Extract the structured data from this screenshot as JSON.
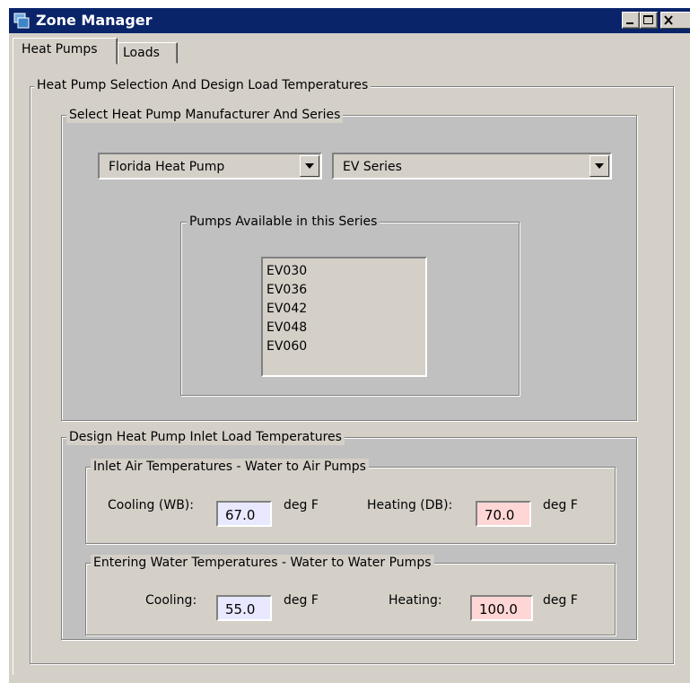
{
  "window": {
    "title": "Zone Manager",
    "controls": {
      "minimize": "minimize-icon",
      "maximize": "maximize-icon",
      "close": "close-icon"
    }
  },
  "tabs": [
    {
      "label": "Heat Pumps",
      "selected": true
    },
    {
      "label": "Loads",
      "selected": false
    }
  ],
  "main_group": {
    "legend": "Heat Pump Selection And Design Load Temperatures"
  },
  "manufacturer_group": {
    "legend": "Select Heat Pump Manufacturer And Series",
    "manufacturer": "Florida Heat Pump",
    "series": "EV Series",
    "pumps_group": {
      "legend": "Pumps Available in this Series",
      "items": [
        "EV030",
        "EV036",
        "EV042",
        "EV048",
        "EV060"
      ]
    }
  },
  "design_group": {
    "legend": "Design Heat Pump Inlet Load Temperatures",
    "air": {
      "legend": "Inlet Air Temperatures - Water to Air Pumps",
      "cooling_label": "Cooling (WB):",
      "cooling_value": "67.0",
      "heating_label": "Heating (DB):",
      "heating_value": "70.0",
      "unit": "deg F"
    },
    "water": {
      "legend": "Entering Water Temperatures - Water to Water Pumps",
      "cooling_label": "Cooling:",
      "cooling_value": "55.0",
      "heating_label": "Heating:",
      "heating_value": "100.0",
      "unit": "deg F"
    }
  },
  "colors": {
    "titlebar": "#0a246a",
    "cooling_field": "#e8e8ff",
    "heating_field": "#ffd6d6",
    "panel": "#d4d0c8",
    "inner_panel": "#c0c0c0"
  }
}
